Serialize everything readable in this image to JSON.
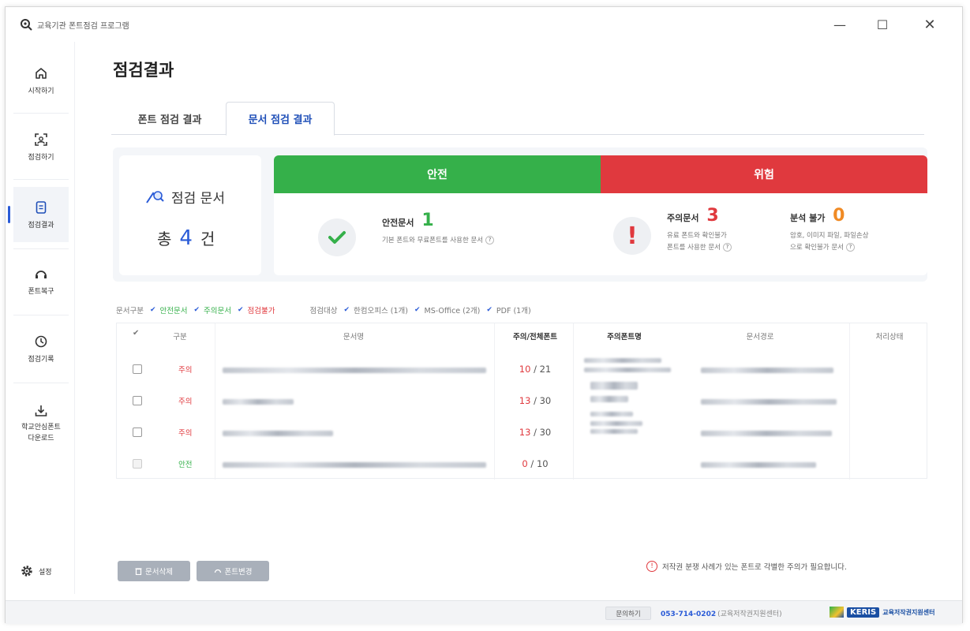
{
  "window": {
    "title": "교육기관 폰트점검 프로그램",
    "minimize": "—",
    "maximize": "☐",
    "close": "✕"
  },
  "sidebar": {
    "items": [
      {
        "label": "시작하기",
        "icon": "home-icon"
      },
      {
        "label": "점검하기",
        "icon": "scan-icon"
      },
      {
        "label": "점검결과",
        "icon": "document-icon"
      },
      {
        "label": "폰트복구",
        "icon": "restore-icon"
      },
      {
        "label": "점검기록",
        "icon": "clock-icon"
      },
      {
        "label": "학교안심폰트",
        "label2": "다운로드",
        "icon": "download-icon"
      }
    ],
    "settings_label": "설정"
  },
  "page": {
    "title": "점검결과"
  },
  "tabs": [
    {
      "label": "폰트 점검 결과",
      "active": false
    },
    {
      "label": "문서 점검 결과",
      "active": true
    }
  ],
  "summary": {
    "total_label": "점검 문서",
    "total_prefix": "총",
    "total_count": "4",
    "total_suffix": "건",
    "safe_header": "안전",
    "danger_header": "위험",
    "safe_label": "안전문서",
    "safe_count": "1",
    "safe_desc": "기본 폰트와 무료폰트를 사용한 문서",
    "caution_label": "주의문서",
    "caution_count": "3",
    "caution_desc_1": "유료 폰트와 확인불가",
    "caution_desc_2": "폰트를 사용한 문서",
    "unable_label": "분석 불가",
    "unable_count": "0",
    "unable_desc_1": "암호, 이미지 파일, 파일손상",
    "unable_desc_2": "으로 확인불가 문서",
    "help": "?"
  },
  "filters": {
    "type_label": "문서구분",
    "type_options": [
      "안전문서",
      "주의문서",
      "점검불가"
    ],
    "target_label": "점검대상",
    "target_options": [
      "한컴오피스 (1개)",
      "MS-Office (2개)",
      "PDF (1개)"
    ]
  },
  "table": {
    "headers": [
      "구분",
      "문서명",
      "주의/전체폰트",
      "주의폰트명",
      "문서경로",
      "처리상태"
    ],
    "rows": [
      {
        "type": "주의",
        "status": "caution",
        "warn": "10",
        "total": "21"
      },
      {
        "type": "주의",
        "status": "caution",
        "warn": "13",
        "total": "30"
      },
      {
        "type": "주의",
        "status": "caution",
        "warn": "13",
        "total": "30"
      },
      {
        "type": "안전",
        "status": "safe",
        "warn": "0",
        "total": "10"
      }
    ],
    "ratio_sep": "/"
  },
  "actions": {
    "delete_label": "문서삭제",
    "change_label": "폰트변경",
    "notice": "저작권 분쟁 사례가 있는 폰트로 각별한 주의가 필요합니다."
  },
  "footer": {
    "contact_label": "문의하기",
    "phone": "053-714-0202",
    "org": "(교육저작권지원센터)",
    "logo_box": "KERIS",
    "logo_text": "교육저작권지원센터"
  },
  "colors": {
    "safe": "#35b04a",
    "danger": "#e0393e",
    "accent": "#2a5bd7"
  }
}
